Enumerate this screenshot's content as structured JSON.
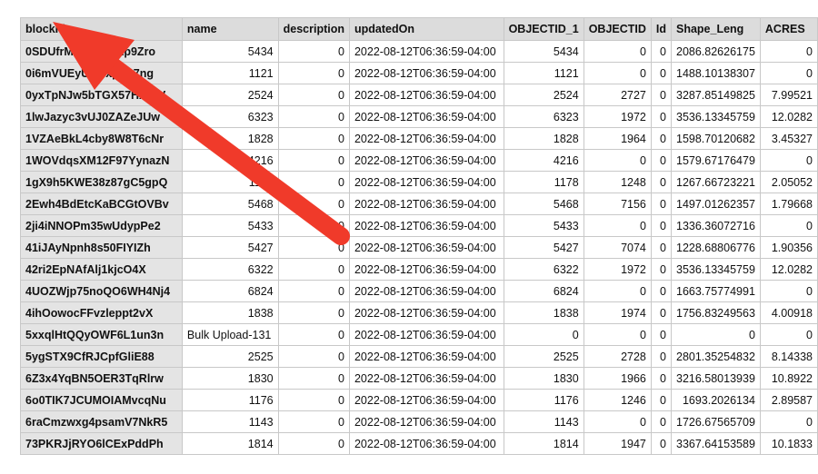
{
  "table": {
    "columns": [
      "blockId",
      "name",
      "description",
      "updatedOn",
      "OBJECTID_1",
      "OBJECTID",
      "Id",
      "Shape_Leng",
      "ACRES"
    ],
    "rows": [
      [
        "0SDUfrMrW8Np1Ep9Zro",
        "5434",
        "0",
        "2022-08-12T06:36:59-04:00",
        "5434",
        "0",
        "0",
        "2086.82626175",
        "0"
      ],
      [
        "0i6mVUEyUlhcxpEu7ng",
        "1121",
        "0",
        "2022-08-12T06:36:59-04:00",
        "1121",
        "0",
        "0",
        "1488.10138307",
        "0"
      ],
      [
        "0yxTpNJw5bTGX57HxsJV",
        "2524",
        "0",
        "2022-08-12T06:36:59-04:00",
        "2524",
        "2727",
        "0",
        "3287.85149825",
        "7.99521"
      ],
      [
        "1lwJazyc3vUJ0ZAZeJUw",
        "6323",
        "0",
        "2022-08-12T06:36:59-04:00",
        "6323",
        "1972",
        "0",
        "3536.13345759",
        "12.0282"
      ],
      [
        "1VZAeBkL4cby8W8T6cNr",
        "1828",
        "0",
        "2022-08-12T06:36:59-04:00",
        "1828",
        "1964",
        "0",
        "1598.70120682",
        "3.45327"
      ],
      [
        "1WOVdqsXM12F97YynazN",
        "4216",
        "0",
        "2022-08-12T06:36:59-04:00",
        "4216",
        "0",
        "0",
        "1579.67176479",
        "0"
      ],
      [
        "1gX9h5KWE38z87gC5gpQ",
        "1178",
        "0",
        "2022-08-12T06:36:59-04:00",
        "1178",
        "1248",
        "0",
        "1267.66723221",
        "2.05052"
      ],
      [
        "2Ewh4BdEtcKaBCGtOVBv",
        "5468",
        "0",
        "2022-08-12T06:36:59-04:00",
        "5468",
        "7156",
        "0",
        "1497.01262357",
        "1.79668"
      ],
      [
        "2ji4iNNOPm35wUdypPe2",
        "5433",
        "0",
        "2022-08-12T06:36:59-04:00",
        "5433",
        "0",
        "0",
        "1336.36072716",
        "0"
      ],
      [
        "41iJAyNpnh8s50FIYIZh",
        "5427",
        "0",
        "2022-08-12T06:36:59-04:00",
        "5427",
        "7074",
        "0",
        "1228.68806776",
        "1.90356"
      ],
      [
        "42ri2EpNAfAlj1kjcO4X",
        "6322",
        "0",
        "2022-08-12T06:36:59-04:00",
        "6322",
        "1972",
        "0",
        "3536.13345759",
        "12.0282"
      ],
      [
        "4UOZWjp75noQO6WH4Nj4",
        "6824",
        "0",
        "2022-08-12T06:36:59-04:00",
        "6824",
        "0",
        "0",
        "1663.75774991",
        "0"
      ],
      [
        "4ihOowocFFvzleppt2vX",
        "1838",
        "0",
        "2022-08-12T06:36:59-04:00",
        "1838",
        "1974",
        "0",
        "1756.83249563",
        "4.00918"
      ],
      [
        "5xxqlHtQQyOWF6L1un3n",
        "Bulk Upload-131",
        "0",
        "2022-08-12T06:36:59-04:00",
        "0",
        "0",
        "0",
        "0",
        "0"
      ],
      [
        "5ygSTX9CfRJCpfGliE88",
        "2525",
        "0",
        "2022-08-12T06:36:59-04:00",
        "2525",
        "2728",
        "0",
        "2801.35254832",
        "8.14338"
      ],
      [
        "6Z3x4YqBN5OER3TqRlrw",
        "1830",
        "0",
        "2022-08-12T06:36:59-04:00",
        "1830",
        "1966",
        "0",
        "3216.58013939",
        "10.8922"
      ],
      [
        "6o0TIK7JCUMOIAMvcqNu",
        "1176",
        "0",
        "2022-08-12T06:36:59-04:00",
        "1176",
        "1246",
        "0",
        "1693.2026134",
        "2.89587"
      ],
      [
        "6raCmzwxg4psamV7NkR5",
        "1143",
        "0",
        "2022-08-12T06:36:59-04:00",
        "1143",
        "0",
        "0",
        "1726.67565709",
        "0"
      ],
      [
        "73PKRJjRYO6lCExPddPh",
        "1814",
        "0",
        "2022-08-12T06:36:59-04:00",
        "1814",
        "1947",
        "0",
        "3367.64153589",
        "10.1833"
      ]
    ]
  },
  "annotation": {
    "arrow_color": "#f03a2a",
    "icon": "red-arrow-icon"
  }
}
